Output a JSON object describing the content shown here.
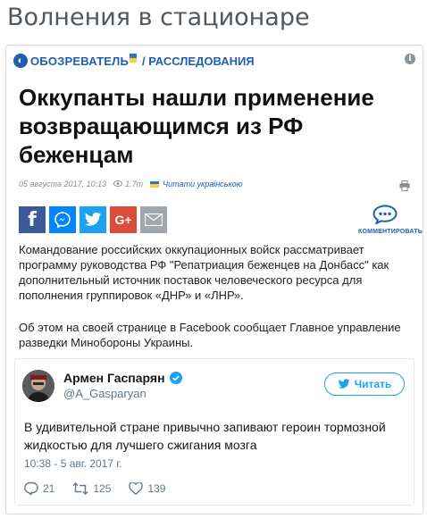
{
  "page": {
    "title": "Волнения в стационаре"
  },
  "article": {
    "logo_text": "ОБОЗРЕВАТЕЛЬ",
    "section": "/ РАССЛЕДОВАНИЯ",
    "headline": "Оккупанты нашли применение возвращающимся из РФ беженцам",
    "date": "05 августа 2017, 10:13",
    "views": "1.7т",
    "read_ua": "Читати українською",
    "comments_label": "КОММЕНТИРОВАТЬ",
    "paragraph1": "Командование российских оккупационных войск рассматривает программу руководства РФ \"Репатриация беженцев на Донбасс\" как дополнительный источник поставок человеческого ресурса для пополнения группировок «ДНР» и «ЛНР».",
    "paragraph2": "Об этом на своей странице в Facebook сообщает Главное управление разведки Минобороны Украины."
  },
  "tweet": {
    "name": "Армен Гаспарян",
    "handle": "@A_Gasparyan",
    "follow_label": "Читать",
    "text": "В удивительной стране привычно запивают героин тормозной жидкостью для лучшего сжигания мозга",
    "time": "10:38 - 5 авг. 2017 г.",
    "replies": "21",
    "retweets": "125",
    "likes": "139"
  },
  "colors": {
    "accent": "#1d5fb3",
    "twitter": "#1da1f2",
    "facebook": "#3b5998",
    "google": "#dd4b39"
  },
  "icons": [
    "info-icon",
    "eye-icon",
    "ukraine-flag-icon",
    "print-icon",
    "facebook-icon",
    "messenger-icon",
    "twitter-icon",
    "google-plus-icon",
    "email-icon",
    "comment-bubble-icon",
    "verified-badge-icon",
    "twitter-bird-icon",
    "reply-icon",
    "retweet-icon",
    "like-icon"
  ]
}
